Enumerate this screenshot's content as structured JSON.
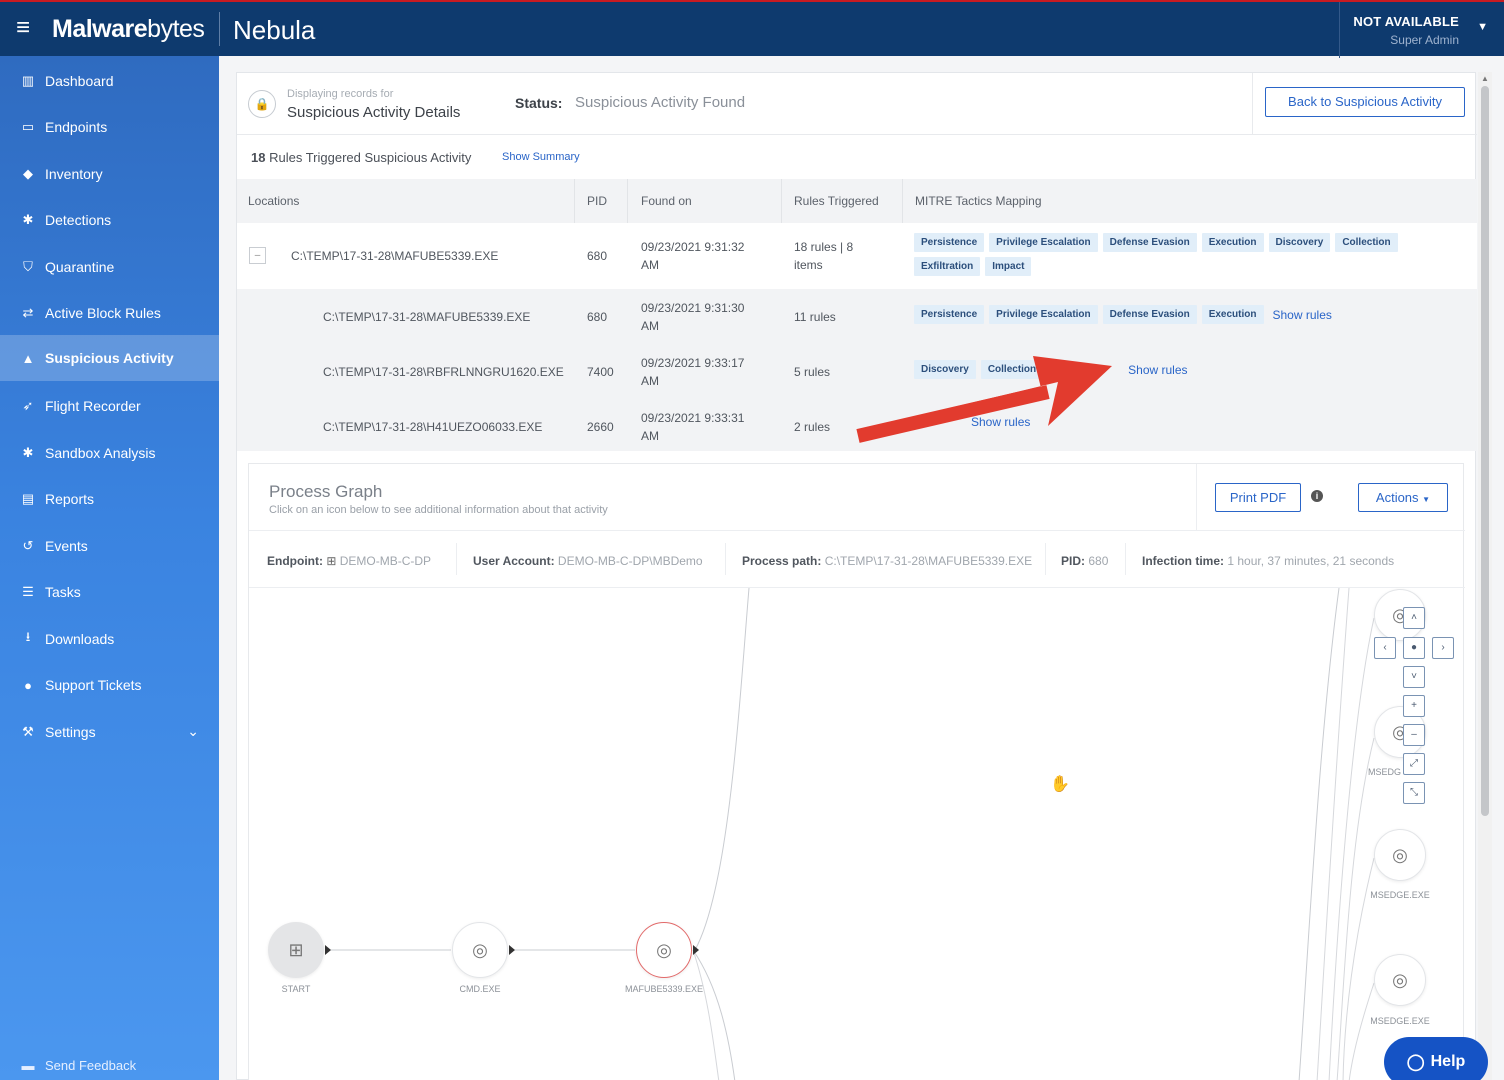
{
  "topbar": {
    "logo_bold": "Malware",
    "logo_light": "bytes",
    "product": "Nebula",
    "user_name": "NOT AVAILABLE",
    "user_role": "Super Admin"
  },
  "sidebar": {
    "items": [
      {
        "label": "Dashboard",
        "icon": "bar-chart-icon"
      },
      {
        "label": "Endpoints",
        "icon": "monitor-icon"
      },
      {
        "label": "Inventory",
        "icon": "tag-icon"
      },
      {
        "label": "Detections",
        "icon": "bug-icon"
      },
      {
        "label": "Quarantine",
        "icon": "shield-icon"
      },
      {
        "label": "Active Block Rules",
        "icon": "arrows-icon"
      },
      {
        "label": "Suspicious Activity",
        "icon": "lock-icon"
      },
      {
        "label": "Flight Recorder",
        "icon": "paper-plane-icon"
      },
      {
        "label": "Sandbox Analysis",
        "icon": "bug-icon"
      },
      {
        "label": "Reports",
        "icon": "document-icon"
      },
      {
        "label": "Events",
        "icon": "history-icon"
      },
      {
        "label": "Tasks",
        "icon": "list-icon"
      },
      {
        "label": "Downloads",
        "icon": "download-icon"
      },
      {
        "label": "Support Tickets",
        "icon": "chat-icon"
      },
      {
        "label": "Settings",
        "icon": "wrench-icon"
      }
    ],
    "active_index": 6,
    "feedback": "Send Feedback"
  },
  "details": {
    "displaying_small": "Displaying records for",
    "title": "Suspicious Activity Details",
    "status_label": "Status:",
    "status_value": "Suspicious Activity Found",
    "back_button": "Back to Suspicious Activity",
    "rules_count": "18",
    "rules_text": "Rules Triggered Suspicious Activity",
    "show_summary": "Show Summary"
  },
  "table": {
    "headers": [
      "Locations",
      "PID",
      "Found on",
      "Rules Triggered",
      "MITRE Tactics Mapping"
    ],
    "main_row": {
      "location": "C:\\TEMP\\17-31-28\\MAFUBE5339.EXE",
      "pid": "680",
      "found_line1": "09/23/2021 9:31:32",
      "found_line2": "AM",
      "rules_line1": "18 rules | 8",
      "rules_line2": "items",
      "tags": [
        "Persistence",
        "Privilege Escalation",
        "Defense Evasion",
        "Execution",
        "Discovery",
        "Collection",
        "Exfiltration",
        "Impact"
      ]
    },
    "child_rows": [
      {
        "location": "C:\\TEMP\\17-31-28\\MAFUBE5339.EXE",
        "pid": "680",
        "found_line1": "09/23/2021 9:31:30",
        "found_line2": "AM",
        "rules": "11 rules",
        "tags": [
          "Persistence",
          "Privilege Escalation",
          "Defense Evasion",
          "Execution"
        ],
        "show_rules": "Show rules"
      },
      {
        "location": "C:\\TEMP\\17-31-28\\RBFRLNNGRU1620.EXE",
        "pid": "7400",
        "found_line1": "09/23/2021 9:33:17",
        "found_line2": "AM",
        "rules": "5 rules",
        "tags": [
          "Discovery",
          "Collection"
        ],
        "show_rules": "Show rules"
      },
      {
        "location": "C:\\TEMP\\17-31-28\\H41UEZO06033.EXE",
        "pid": "2660",
        "found_line1": "09/23/2021 9:33:31",
        "found_line2": "AM",
        "rules": "2 rules",
        "tags": [],
        "show_rules": "Show rules"
      }
    ]
  },
  "graph": {
    "title": "Process Graph",
    "subtitle": "Click on an icon below to see additional information about that activity",
    "print_pdf": "Print PDF",
    "actions": "Actions",
    "meta": {
      "endpoint_label": "Endpoint:",
      "endpoint_value": "DEMO-MB-C-DP",
      "account_label": "User Account:",
      "account_value": "DEMO-MB-C-DP\\MBDemo",
      "path_label": "Process path:",
      "path_value": "C:\\TEMP\\17-31-28\\MAFUBE5339.EXE",
      "pid_label": "PID:",
      "pid_value": "680",
      "infection_label": "Infection time:",
      "infection_value": "1 hour, 37 minutes, 21 seconds"
    },
    "nodes": {
      "start": "START",
      "cmd": "CMD.EXE",
      "mafube": "MAFUBE5339.EXE",
      "msedge_a": "MSEDGE.EXE",
      "msedge_b": "MSEDGE.EXE",
      "msedge_partial": "MSEDG"
    }
  },
  "help": "Help",
  "colors": {
    "topbar": "#0e3a6e",
    "accent": "#2a65c8",
    "arrow": "#e23b2e",
    "tag_bg": "#e1eef9"
  }
}
